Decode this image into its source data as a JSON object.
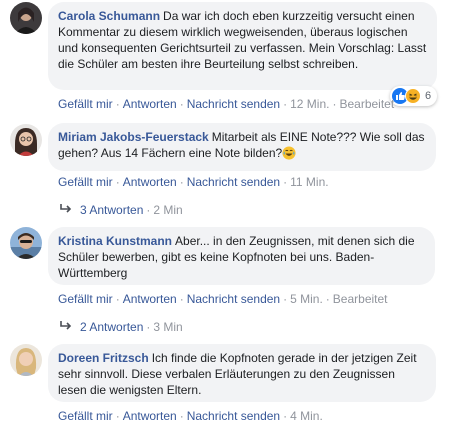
{
  "comments": [
    {
      "author": "Carola Schumann",
      "text": "Da war ich doch eben kurzzeitig versucht einen Kommentar zu diesem wirklich wegweisenden, überaus logischen und konsequenten Gerichtsurteil zu verfassen. Mein Vorschlag: Lasst die Schüler am besten ihre Beurteilung selbst schreiben.",
      "like": "Gefällt mir",
      "reply": "Antworten",
      "message": "Nachricht senden",
      "time": "12 Min.",
      "edited": "Bearbeitet",
      "reactions": {
        "count": "6",
        "icons": [
          "like-icon",
          "haha-icon"
        ],
        "colors": {
          "like": "#1877f2",
          "haha": "#f7b125"
        }
      }
    },
    {
      "author": "Miriam Jakobs-Feuerstack",
      "text": "Mitarbeit als EINE Note??? Wie soll das gehen? Aus 14 Fächern eine Note bilden?",
      "emoji": "tears-of-joy-emoji",
      "like": "Gefällt mir",
      "reply": "Antworten",
      "message": "Nachricht senden",
      "time": "11 Min.",
      "replies": {
        "count": "3 Antworten",
        "time": "2 Min"
      }
    },
    {
      "author": "Kristina Kunstmann",
      "text": "Aber... in den Zeugnissen, mit denen sich die Schüler bewerben, gibt es keine Kopfnoten bei uns. Baden-Württemberg",
      "like": "Gefällt mir",
      "reply": "Antworten",
      "message": "Nachricht senden",
      "time": "5 Min.",
      "edited": "Bearbeitet",
      "replies": {
        "count": "2 Antworten",
        "time": "3 Min"
      }
    },
    {
      "author": "Doreen Fritzsch",
      "text": "Ich finde die Kopfnoten gerade in der jetzigen Zeit sehr sinnvoll. Diese verbalen Erläuterungen zu den Zeugnissen lesen die wenigsten Eltern.",
      "like": "Gefällt mir",
      "reply": "Antworten",
      "message": "Nachricht senden",
      "time": "4 Min."
    }
  ],
  "separator": "·",
  "colors": {
    "link": "#385898",
    "bubble": "#f2f3f5",
    "meta": "#90949c"
  }
}
